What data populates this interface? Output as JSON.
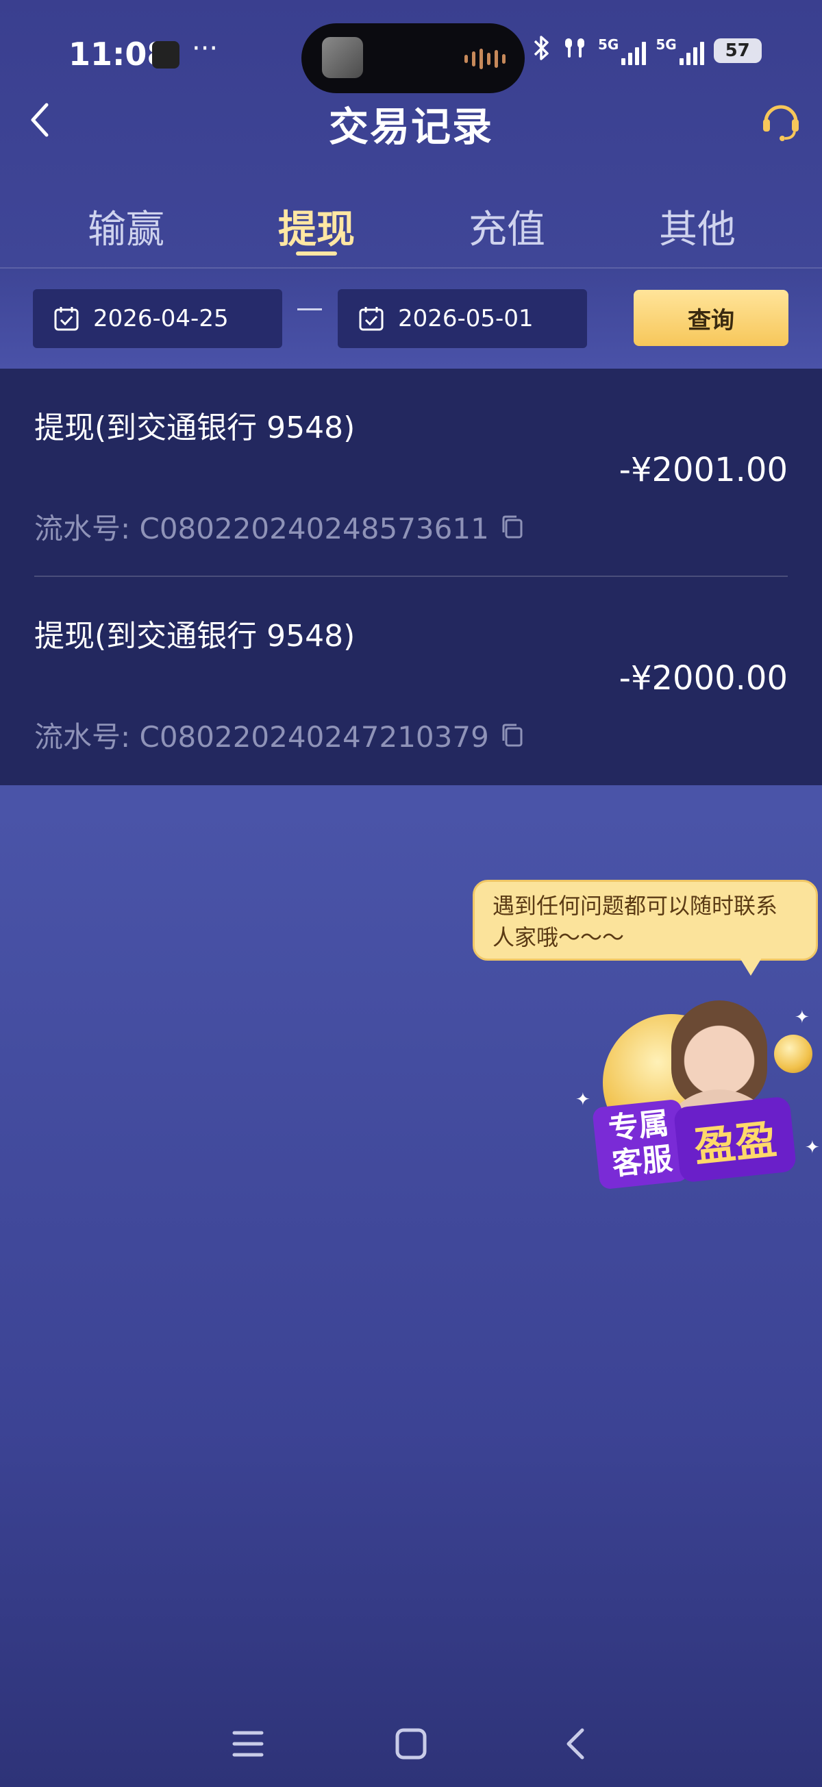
{
  "status_bar": {
    "time": "11:08",
    "more": "···",
    "network1": "5G",
    "network2": "5G",
    "battery": "57"
  },
  "header": {
    "title": "交易记录"
  },
  "tabs": [
    {
      "label": "输赢",
      "active": false
    },
    {
      "label": "提现",
      "active": true
    },
    {
      "label": "充值",
      "active": false
    },
    {
      "label": "其他",
      "active": false
    }
  ],
  "filter": {
    "start_date": "2026-04-25",
    "end_date": "2026-05-01",
    "query_label": "查询"
  },
  "transactions": [
    {
      "title": "提现(到交通银行 9548)",
      "amount": "-¥2001.00",
      "serial": "流水号: C080220240248573611"
    },
    {
      "title": "提现(到交通银行 9548)",
      "amount": "-¥2000.00",
      "serial": "流水号: C080220240247210379"
    }
  ],
  "support": {
    "bubble_text": "遇到任何问题都可以随时联系人家哦～～～",
    "badge_line1": "专属",
    "badge_line2": "客服",
    "badge_name": "盈盈"
  },
  "colors": {
    "accent": "#ffe7a3",
    "button": "#f7c75a",
    "list_bg": "#23285f"
  }
}
